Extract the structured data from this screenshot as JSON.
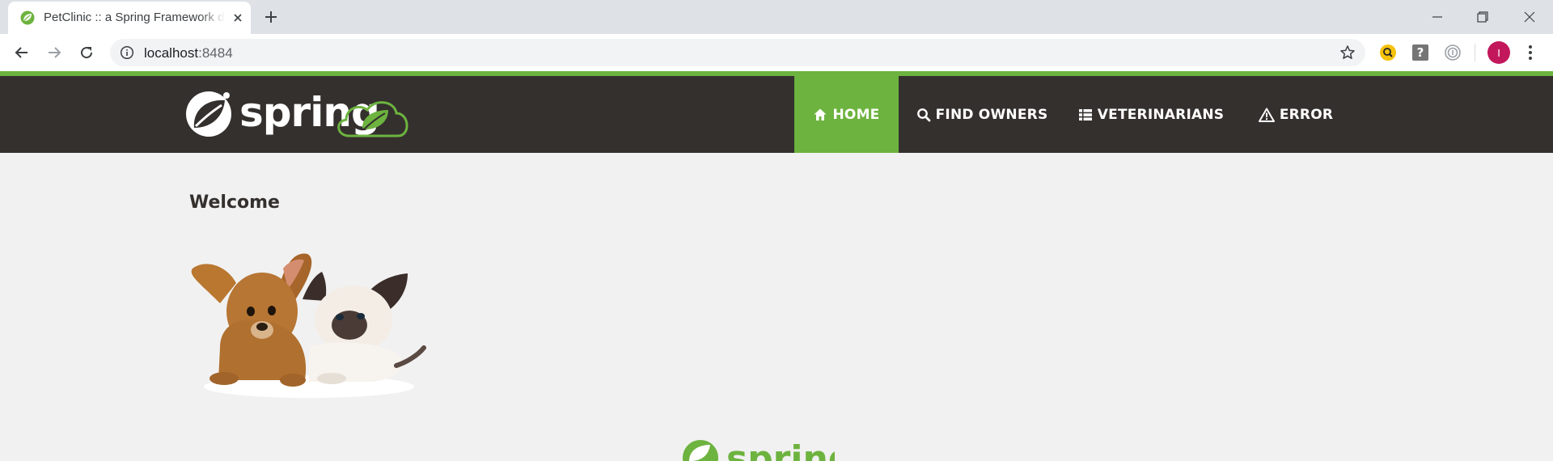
{
  "browser": {
    "tab": {
      "title": "PetClinic :: a Spring Framework demonstration"
    },
    "address": {
      "host": "localhost",
      "port": ":8484"
    }
  },
  "navbar": {
    "items": [
      {
        "label": "Home",
        "icon": "home-icon",
        "active": true
      },
      {
        "label": "Find owners",
        "icon": "search-icon",
        "active": false
      },
      {
        "label": "Veterinarians",
        "icon": "list-icon",
        "active": false
      },
      {
        "label": "Error",
        "icon": "warning-icon",
        "active": false
      }
    ]
  },
  "page": {
    "heading": "Welcome"
  },
  "user": {
    "initial": "I"
  },
  "colors": {
    "brand_green": "#6db33f",
    "navbar_bg": "#34302d",
    "page_bg": "#f1f1f1",
    "avatar": "#c2185b"
  }
}
